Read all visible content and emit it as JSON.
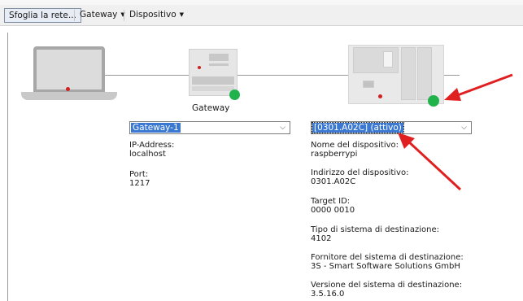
{
  "toolbar": {
    "browse_label": "Sfoglia la rete...",
    "gateway_label": "Gateway",
    "device_label": "Dispositivo"
  },
  "gateway": {
    "caption": "Gateway",
    "selected": "Gateway-1",
    "fields": [
      {
        "label": "IP-Address:",
        "value": "localhost"
      },
      {
        "label": "Port:",
        "value": "1217"
      }
    ]
  },
  "device": {
    "selected": "[0301.A02C] (attivo)",
    "fields": [
      {
        "label": "Nome del dispositivo:",
        "value": "raspberrypi"
      },
      {
        "label": "Indirizzo del dispositivo:",
        "value": "0301.A02C"
      },
      {
        "label": "Target ID:",
        "value": "0000  0010"
      },
      {
        "label": "Tipo di sistema di destinazione:",
        "value": "4102"
      },
      {
        "label": "Fornitore del sistema di destinazione:",
        "value": "3S - Smart Software Solutions GmbH"
      },
      {
        "label": "Versione del sistema di destinazione:",
        "value": "3.5.16.0"
      }
    ]
  },
  "colors": {
    "status_online": "#22b24c",
    "annotation_arrow": "#e02020",
    "selection": "#3a78d2"
  }
}
